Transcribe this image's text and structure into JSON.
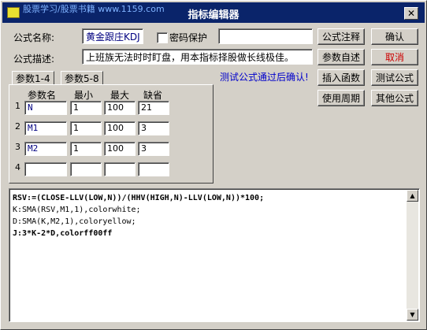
{
  "watermark": "股票学习/股票书籍 www.1159.com",
  "window": {
    "title": "指标编辑器",
    "close_glyph": "✕"
  },
  "form": {
    "name_label": "公式名称:",
    "name_value": "黄金跟庄KDJ",
    "password_label": "密码保护",
    "password_value": "",
    "desc_label": "公式描述:",
    "desc_value": "上班族无法时时盯盘，用本指标择股做长线极佳。"
  },
  "buttons": {
    "annotation": "公式注释",
    "confirm": "确认",
    "param_guide": "参数自述",
    "cancel": "取消",
    "insert_func": "插入函数",
    "test_formula": "测试公式",
    "use_period": "使用周期",
    "other_formula": "其他公式"
  },
  "tabs": [
    {
      "label": "参数1-4"
    },
    {
      "label": "参数5-8"
    }
  ],
  "params": {
    "headers": [
      "参数名",
      "最小",
      "最大",
      "缺省"
    ],
    "rows": [
      {
        "num": "1",
        "name": "N",
        "min": "1",
        "max": "100",
        "default": "21"
      },
      {
        "num": "2",
        "name": "M1",
        "min": "1",
        "max": "100",
        "default": "3"
      },
      {
        "num": "3",
        "name": "M2",
        "min": "1",
        "max": "100",
        "default": "3"
      },
      {
        "num": "4",
        "name": "",
        "min": "",
        "max": "",
        "default": ""
      }
    ]
  },
  "status": "测试公式通过后确认!",
  "code_lines": [
    "RSV:=(CLOSE-LLV(LOW,N))/(HHV(HIGH,N)-LLV(LOW,N))*100;",
    "K:SMA(RSV,M1,1),colorwhite;",
    "D:SMA(K,M2,1),coloryellow;",
    "J:3*K-2*D,colorff00ff"
  ],
  "scroll": {
    "up": "▲",
    "down": "▼"
  }
}
